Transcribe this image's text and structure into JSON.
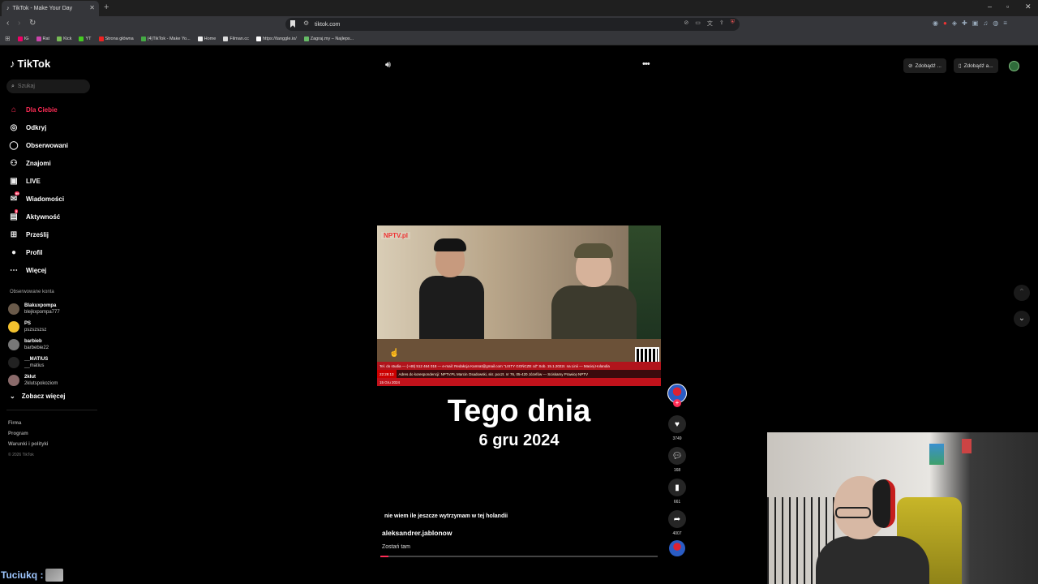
{
  "browser": {
    "tab_title": "TikTok - Make Your Day",
    "url": "tiktok.com",
    "bookmarks": [
      "IG",
      "Rat",
      "Kick",
      "YT",
      "Strona główna",
      "(4)TikTok - Make Yo...",
      "Home",
      "Filman.cc",
      "https://tanggle.io/",
      "Zagraj.my – Najleps..."
    ]
  },
  "sidebar": {
    "logo": "TikTok",
    "search_placeholder": "Szukaj",
    "nav": [
      {
        "label": "Dla Ciebie",
        "icon": "home-icon"
      },
      {
        "label": "Odkryj",
        "icon": "compass-icon"
      },
      {
        "label": "Obserwowani",
        "icon": "following-icon"
      },
      {
        "label": "Znajomi",
        "icon": "friends-icon"
      },
      {
        "label": "LIVE",
        "icon": "live-icon"
      },
      {
        "label": "Wiadomości",
        "icon": "messages-icon",
        "badge": "99"
      },
      {
        "label": "Aktywność",
        "icon": "activity-icon",
        "badge": "3"
      },
      {
        "label": "Prześlij",
        "icon": "upload-icon"
      },
      {
        "label": "Profil",
        "icon": "profile-icon"
      },
      {
        "label": "Więcej",
        "icon": "more-icon"
      }
    ],
    "followed_title": "Obserwowane konta",
    "followed": [
      {
        "user": "Blakuxpompa",
        "name": "blejkxpompa777"
      },
      {
        "user": "PS",
        "name": "pszszszsz"
      },
      {
        "user": "barbieb",
        "name": "barbebie22"
      },
      {
        "user": "__MATIUS",
        "name": "__matius"
      },
      {
        "user": "2kłut",
        "name": "2klutspokoziom"
      }
    ],
    "see_more": "Zobacz więcej",
    "footer": [
      "Firma",
      "Program",
      "Warunki i polityki"
    ],
    "copyright": "© 2026 TikTok"
  },
  "topbar": {
    "btn1": "Zdobądź ...",
    "btn2": "Zdobądź a..."
  },
  "video": {
    "logo": "NPTV.pl",
    "ticker1": "Tel. do studia — (+48) 512 464 018 — e-mail: Redakcja Kamrat@gmail.com     \"LISTY GOŃCZE cd\" Sob. 15.1.2022r. na Linii — Maciej Holandia",
    "time": "22:29:13",
    "ticker2": "Adres do korespondencji: NPTV.PL Marcin Osadowski, skr. poczt. nr 76, 05-420 Józefów --- Sciskamy Prawicę NPTV",
    "ticker3": "15 Gru 2024",
    "headline": "Tego dnia",
    "date": "6 gru 2024",
    "caption": "nie wiem ile jeszcze wytrzymam w tej holandii",
    "author": "aleksandrer.jablonow",
    "description": "Zostań tam",
    "progress": 0.03
  },
  "actions": {
    "likes": "3749",
    "comments": "168",
    "saves": "661",
    "shares": "4007"
  },
  "stream": {
    "chat_user": "Tuciukq :"
  }
}
